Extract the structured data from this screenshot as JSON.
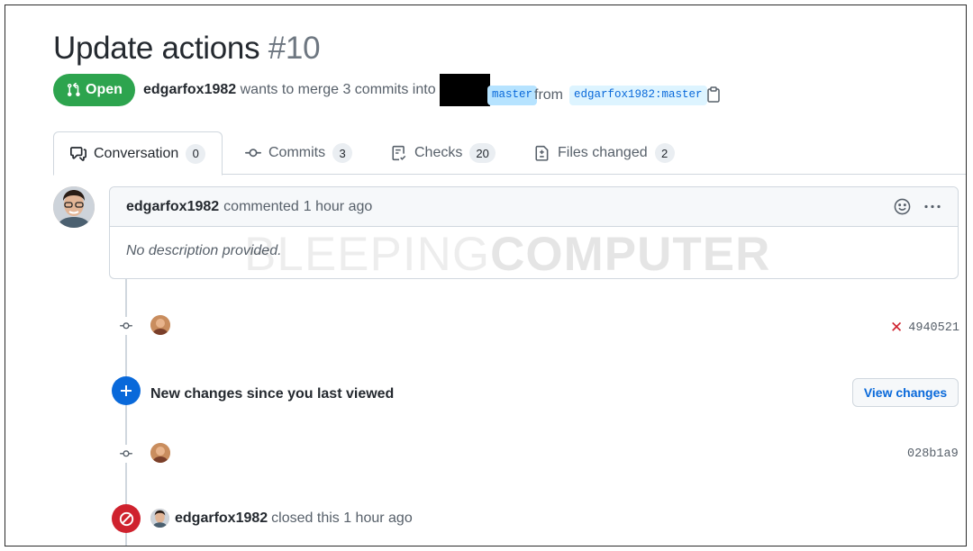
{
  "pr": {
    "title": "Update actions",
    "number": "#10",
    "state": "Open",
    "author": "edgarfox1982",
    "merge_text": "wants to merge 3 commits into",
    "base_branch": "master",
    "from_label": "from",
    "head_branch": "edgarfox1982:master"
  },
  "tabs": [
    {
      "label": "Conversation",
      "count": "0",
      "icon": "comment-discussion-icon"
    },
    {
      "label": "Commits",
      "count": "3",
      "icon": "git-commit-icon"
    },
    {
      "label": "Checks",
      "count": "20",
      "icon": "checklist-icon"
    },
    {
      "label": "Files changed",
      "count": "2",
      "icon": "file-diff-icon"
    }
  ],
  "comment": {
    "author": "edgarfox1982",
    "action": "commented",
    "time": "1 hour ago",
    "body": "No description provided."
  },
  "watermark": {
    "light": "BLEEPING",
    "bold": "COMPUTER"
  },
  "commits": [
    {
      "sha": "4940521",
      "status": "failed",
      "status_icon": "x-icon"
    },
    {
      "sha": "028b1a9"
    }
  ],
  "new_changes": {
    "text": "New changes since you last viewed",
    "button": "View changes"
  },
  "closed_event": {
    "author": "edgarfox1982",
    "text": "closed this 1 hour ago"
  },
  "colors": {
    "open": "#2da44e",
    "link": "#0969da",
    "closed": "#cf222e",
    "border": "#d0d7de"
  }
}
